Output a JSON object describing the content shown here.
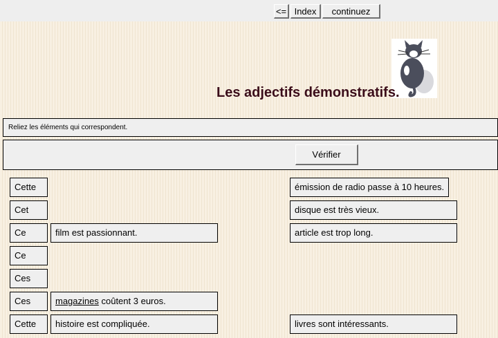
{
  "nav": {
    "back_label": "<=",
    "index_label": "Index",
    "continue_label": "continuez"
  },
  "page_title": "Les adjectifs démonstratifs.",
  "illustration": "cat-illustration",
  "instruction": "Reliez les éléments qui correspondent.",
  "verify_label": "Vérifier",
  "left_words": [
    "Cette",
    "Cet",
    "Ce",
    "Ce",
    "Ces",
    "Ces",
    "Cette"
  ],
  "paired_endings": {
    "film": "film est passionnant.",
    "magazines_word": "magazines",
    "magazines_rest": " coûtent 3 euros.",
    "histoire": "histoire est compliquée."
  },
  "right_endings": [
    "émission de radio passe à 10 heures.",
    "disque est très vieux.",
    "article est trop long.",
    "livres sont intéressants."
  ],
  "colors": {
    "title": "#3b0d1a",
    "background": "#f8f0e2",
    "panel": "#efefef"
  }
}
